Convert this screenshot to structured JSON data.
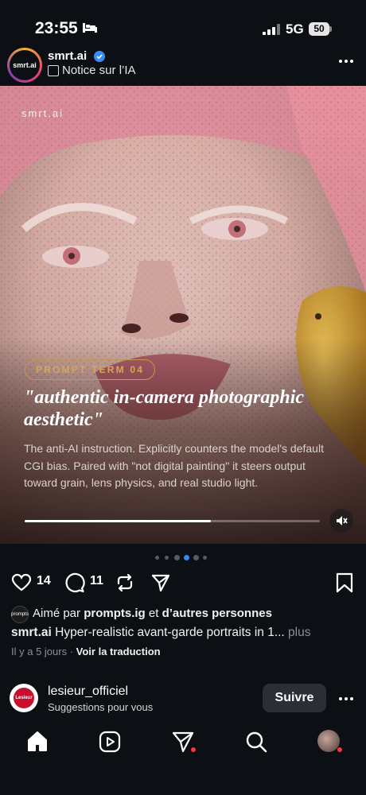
{
  "status_bar": {
    "time": "23:55",
    "network": "5G",
    "battery": "50"
  },
  "post": {
    "account": {
      "name": "smrt.ai",
      "avatar_text": "smrt.ai"
    },
    "notice": "Notice sur l’IA",
    "watermark": "smrt.ai",
    "badge": "PROMPT TERM 04",
    "quote": "\"authentic in-camera photographic aesthetic\"",
    "description": "The anti-AI instruction. Explicitly counters the model's default CGI bias. Paired with \"not digital painting\" it steers output toward grain, lens physics, and real studio light.",
    "video_progress": 0.63,
    "carousel": {
      "count": 6,
      "active_index": 3
    },
    "likes_count": "14",
    "comments_count": "11",
    "liked_by": {
      "avatar_text": "prompts",
      "prefix": "Aimé par ",
      "user": "prompts.ig",
      "middle": " et ",
      "others": "d’autres personnes"
    },
    "caption": {
      "user": "smrt.ai",
      "text": " Hyper-realistic avant-garde portraits in 1...",
      "more": " plus"
    },
    "time_ago": "Il y a 5 jours",
    "separator": " · ",
    "translate": "Voir la traduction"
  },
  "suggestion": {
    "name": "lesieur_officiel",
    "subtitle": "Suggestions pour vous",
    "follow_label": "Suivre",
    "avatar_text": "Lesieur"
  },
  "colors": {
    "background": "#0c0f14",
    "badge": "#d8a55b",
    "accent": "#3b82f6",
    "notification": "#ff3040"
  },
  "icons": [
    "bed-icon",
    "signal-icon",
    "battery-icon",
    "verified-icon",
    "notice-icon",
    "more-icon",
    "mute-icon",
    "heart-icon",
    "comment-icon",
    "repost-icon",
    "share-icon",
    "bookmark-icon",
    "home-icon",
    "reels-icon",
    "messages-icon",
    "search-icon",
    "profile-icon"
  ]
}
